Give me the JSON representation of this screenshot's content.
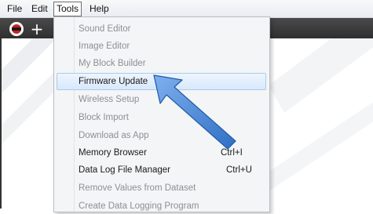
{
  "menubar": {
    "items": [
      "File",
      "Edit",
      "Tools",
      "Help"
    ],
    "active": "Tools"
  },
  "toolbar": {
    "app_icon": "lego-brick-icon",
    "add_icon": "plus-icon"
  },
  "tools_menu": {
    "items": [
      {
        "label": "Sound Editor",
        "enabled": false
      },
      {
        "label": "Image Editor",
        "enabled": false
      },
      {
        "label": "My Block Builder",
        "enabled": false
      },
      {
        "label": "Firmware Update",
        "enabled": true,
        "highlighted": true
      },
      {
        "label": "Wireless Setup",
        "enabled": false
      },
      {
        "label": "Block Import",
        "enabled": false
      },
      {
        "label": "Download as App",
        "enabled": false
      },
      {
        "label": "Memory Browser",
        "enabled": true,
        "shortcut": "Ctrl+I"
      },
      {
        "label": "Data Log File Manager",
        "enabled": true,
        "shortcut": "Ctrl+U"
      },
      {
        "label": "Remove Values from Dataset",
        "enabled": false
      },
      {
        "label": "Create Data Logging Program",
        "enabled": false
      }
    ]
  },
  "annotation": {
    "arrow_icon": "blue-pointer-arrow-icon",
    "arrow_color": "#4a86d8"
  }
}
